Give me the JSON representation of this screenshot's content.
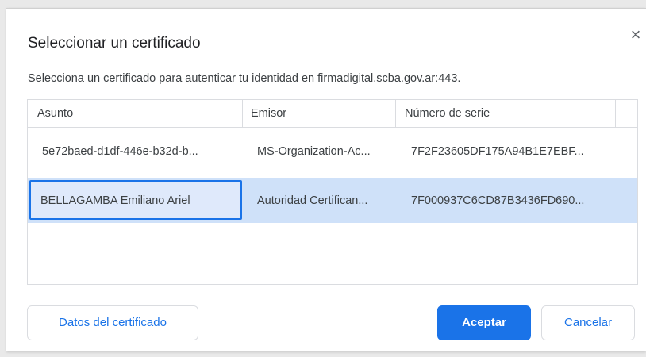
{
  "dialog": {
    "title": "Seleccionar un certificado",
    "subtitle": "Selecciona un certificado para autenticar tu identidad en firmadigital.scba.gov.ar:443.",
    "close_glyph": "×"
  },
  "table": {
    "columns": [
      "Asunto",
      "Emisor",
      "Número de serie"
    ],
    "rows": [
      {
        "asunto": "5e72baed-d1df-446e-b32d-b...",
        "emisor": "MS-Organization-Ac...",
        "serie": "7F2F23605DF175A94B1E7EBF..."
      },
      {
        "asunto": "BELLAGAMBA Emiliano Ariel",
        "emisor": "Autoridad Certifican...",
        "serie": "7F000937C6CD87B3436FD690..."
      }
    ],
    "selected_row": 1
  },
  "buttons": {
    "details_label": "Datos del certificado",
    "accept_label": "Aceptar",
    "cancel_label": "Cancelar"
  },
  "colors": {
    "accent": "#1a73e8",
    "selected_row_bg": "#cfe1f9"
  },
  "icons": {
    "close": "close-icon"
  }
}
